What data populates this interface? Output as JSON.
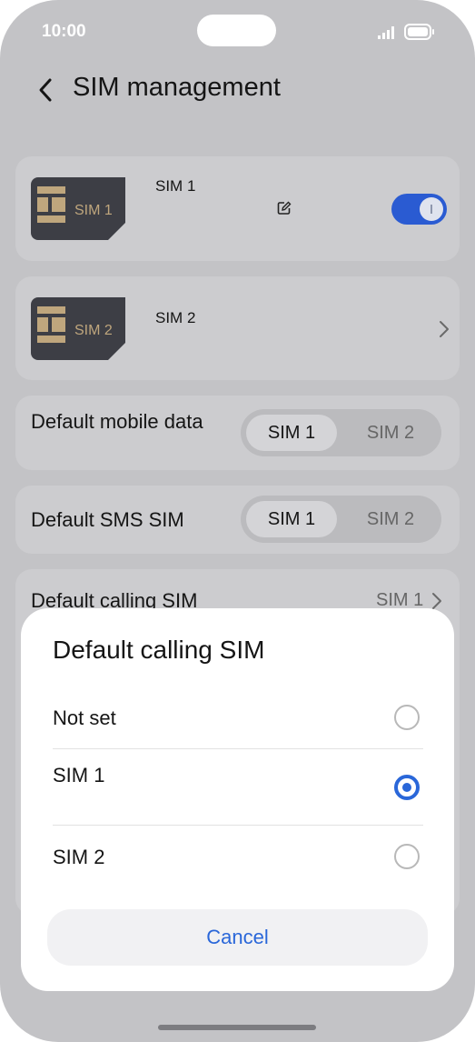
{
  "status_bar": {
    "time": "10:00"
  },
  "header": {
    "title": "SIM management"
  },
  "sim_cards": [
    {
      "chip_label": "SIM 1",
      "name": "SIM 1",
      "enabled": true
    },
    {
      "chip_label": "SIM 2",
      "name": "SIM 2"
    }
  ],
  "default_mobile_data": {
    "label": "Default mobile data",
    "options": [
      "SIM 1",
      "SIM 2"
    ],
    "selected": "SIM 1"
  },
  "default_sms": {
    "label": "Default SMS SIM",
    "options": [
      "SIM 1",
      "SIM 2"
    ],
    "selected": "SIM 1"
  },
  "default_calling": {
    "label": "Default calling SIM",
    "value": "SIM 1"
  },
  "dialog": {
    "title": "Default calling SIM",
    "options": [
      {
        "label": "Not set",
        "selected": false
      },
      {
        "label": "SIM 1",
        "selected": true
      },
      {
        "label": "SIM 2",
        "selected": false
      }
    ],
    "cancel_label": "Cancel"
  },
  "colors": {
    "accent": "#2a67d9",
    "toggle_on": "#2a5bd2",
    "overlay_bg": "#c3c3c6",
    "chip_bg": "#3d3e45",
    "chip_gold": "#bfa67d"
  }
}
